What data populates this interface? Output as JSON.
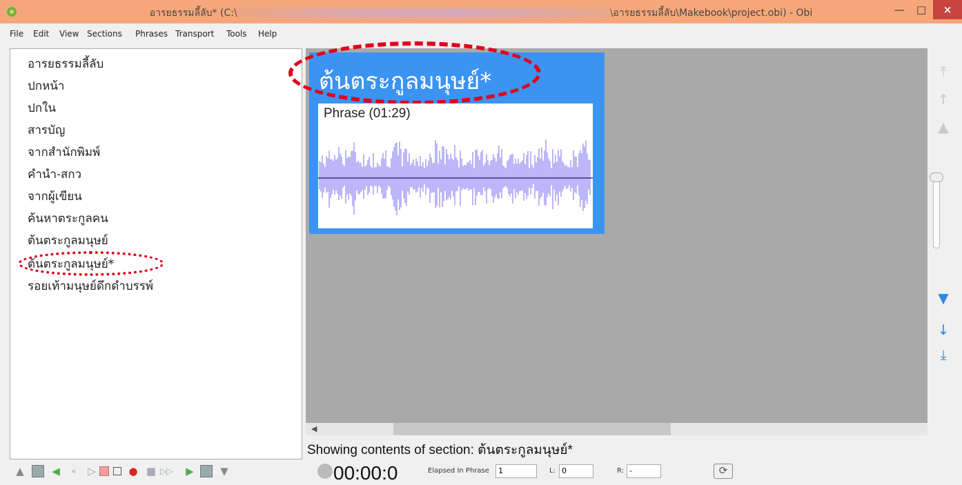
{
  "window": {
    "title_left": "อารยธรรมลี้ลับ* (C:\\",
    "title_right": "\\อารยธรรมลี้ลับ\\Makebook\\project.obi) - Obi",
    "min_icon": "minimize-icon",
    "max_icon": "maximize-icon",
    "close_icon": "close-icon"
  },
  "menu": [
    "File",
    "Edit",
    "View",
    "Sections",
    "Phrases",
    "Transport",
    "Tools",
    "Help"
  ],
  "toc": {
    "items": [
      "อารยธรรมลี้ลับ",
      "ปกหน้า",
      "ปกใน",
      "สารบัญ",
      "จากสำนักพิมพ์",
      "คำนำ-สกว",
      "จากผู้เขียน",
      "ค้นหาตระกูลคน",
      "ต้นตระกูลมนุษย์",
      "ต้นตระกูลมนุษย์*",
      "รอยเท้ามนุษย์ดึกดำบรรพ์"
    ],
    "selected_index": 9
  },
  "strip": {
    "title": "ต้นตระกูลมนุษย์*",
    "phrase_label": "Phrase (01:29)",
    "wave_color": "#7b6cf0",
    "strip_color": "#3b93f2"
  },
  "status": {
    "text": "Showing contents of section:  ต้นตระกูลมนุษย์*"
  },
  "transport": {
    "time": "00:00:0",
    "elapsed_label": "Elapsed In Phrase",
    "elapsed_value": "1",
    "l_label": "L:",
    "l_value": "0",
    "r_label": "R:",
    "r_value": "-"
  },
  "icons": {
    "nav_top": "go-to-top-icon",
    "nav_up": "arrow-up-icon",
    "nav_page_up": "page-up-icon",
    "nav_page_down": "page-down-icon",
    "nav_down": "arrow-down-icon",
    "nav_bottom": "go-to-bottom-icon"
  },
  "colors": {
    "titlebar": "#f5a77b",
    "accent_blue": "#3b93f2",
    "annotation_red": "#e0001a"
  }
}
